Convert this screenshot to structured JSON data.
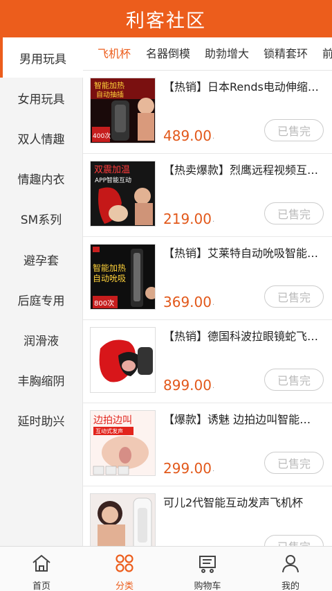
{
  "header": {
    "title": "利客社区"
  },
  "sidebar": {
    "items": [
      {
        "label": "男用玩具",
        "active": true
      },
      {
        "label": "女用玩具"
      },
      {
        "label": "双人情趣"
      },
      {
        "label": "情趣内衣"
      },
      {
        "label": "SM系列"
      },
      {
        "label": "避孕套"
      },
      {
        "label": "后庭专用"
      },
      {
        "label": "润滑液"
      },
      {
        "label": "丰胸缩阴"
      },
      {
        "label": "延时助兴"
      }
    ]
  },
  "tabs": [
    {
      "label": "飞机杯",
      "active": true
    },
    {
      "label": "名器倒模"
    },
    {
      "label": "助勃增大"
    },
    {
      "label": "锁精套环"
    },
    {
      "label": "前"
    }
  ],
  "products": [
    {
      "title": "【热销】日本Rends电动伸缩旋转飞机杯",
      "price": "489.00",
      "sold_label": "已售完",
      "thumb_text_top": "智能加热",
      "thumb_text_mid": "自动抽插",
      "thumb_text_bottom": "400次"
    },
    {
      "title": "【热卖爆款】烈鹰远程视频互动飞机杯",
      "price": "219.00",
      "sold_label": "已售完",
      "thumb_text_top": "双震加温",
      "thumb_text_mid": "APP智能互动",
      "thumb_text_bottom": ""
    },
    {
      "title": "【热销】艾莱特自动吮吸智能飞机杯",
      "price": "369.00",
      "sold_label": "已售完",
      "thumb_text_top": "智能加热",
      "thumb_text_mid": "自动吮吸",
      "thumb_text_bottom": "800次"
    },
    {
      "title": "【热销】德国科波拉眼镜蛇飞机杯",
      "price": "899.00",
      "sold_label": "已售完",
      "thumb_text_top": "",
      "thumb_text_mid": "",
      "thumb_text_bottom": ""
    },
    {
      "title": "【爆款】诱魅 边拍边叫智能飞机杯",
      "price": "299.00",
      "sold_label": "已售完",
      "thumb_text_top": "边拍边叫",
      "thumb_text_mid": "互动式发声",
      "thumb_text_bottom": ""
    },
    {
      "title": "可儿2代智能互动发声飞机杯",
      "price": "",
      "sold_label": "已售完",
      "thumb_text_top": "",
      "thumb_text_mid": "",
      "thumb_text_bottom": ""
    }
  ],
  "price_tick": "·",
  "tabbar": [
    {
      "label": "首页",
      "icon": "home-icon"
    },
    {
      "label": "分类",
      "icon": "category-icon",
      "active": true
    },
    {
      "label": "购物车",
      "icon": "cart-icon"
    },
    {
      "label": "我的",
      "icon": "user-icon"
    }
  ],
  "colors": {
    "brand": "#ec5d1c",
    "price": "#e2581a"
  }
}
